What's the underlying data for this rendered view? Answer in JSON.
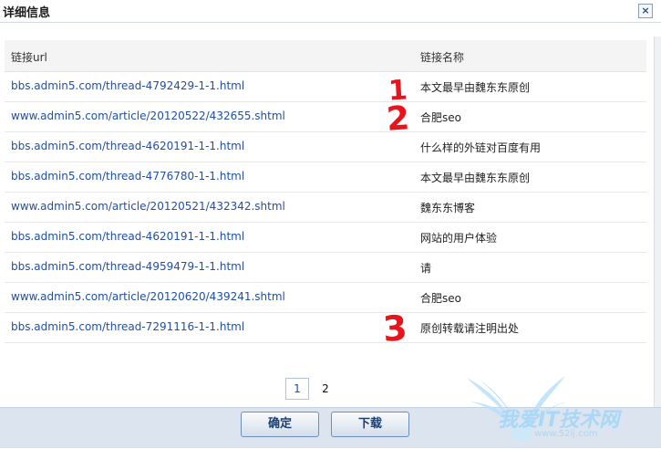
{
  "dialog": {
    "title": "详细信息",
    "close_symbol": "×"
  },
  "table": {
    "header": {
      "url": "链接url",
      "name": "链接名称"
    },
    "rows": [
      {
        "url": "bbs.admin5.com/thread-4792429-1-1.html",
        "name": "本文最早由魏东东原创"
      },
      {
        "url": "www.admin5.com/article/20120522/432655.shtml",
        "name": "合肥seo"
      },
      {
        "url": "bbs.admin5.com/thread-4620191-1-1.html",
        "name": "什么样的外链对百度有用"
      },
      {
        "url": "bbs.admin5.com/thread-4776780-1-1.html",
        "name": "本文最早由魏东东原创"
      },
      {
        "url": "www.admin5.com/article/20120521/432342.shtml",
        "name": "魏东东博客"
      },
      {
        "url": "bbs.admin5.com/thread-4620191-1-1.html",
        "name": "网站的用户体验"
      },
      {
        "url": "bbs.admin5.com/thread-4959479-1-1.html",
        "name": "请"
      },
      {
        "url": "www.admin5.com/article/20120620/439241.shtml",
        "name": "合肥seo"
      },
      {
        "url": "bbs.admin5.com/thread-7291116-1-1.html",
        "name": "原创转载请注明出处"
      }
    ]
  },
  "pagination": {
    "pages": [
      "1",
      "2"
    ],
    "current": "1"
  },
  "buttons": {
    "confirm": "确定",
    "download": "下载"
  },
  "annotations": [
    "1",
    "2",
    "3"
  ],
  "watermark": {
    "text": "我爱IT技术网",
    "url": "www.52ij.com"
  },
  "colors": {
    "link": "#1f4fa6",
    "annotation": "#e8141b",
    "footer": "#dbe4ef",
    "watermark": "#9fd3f5"
  }
}
